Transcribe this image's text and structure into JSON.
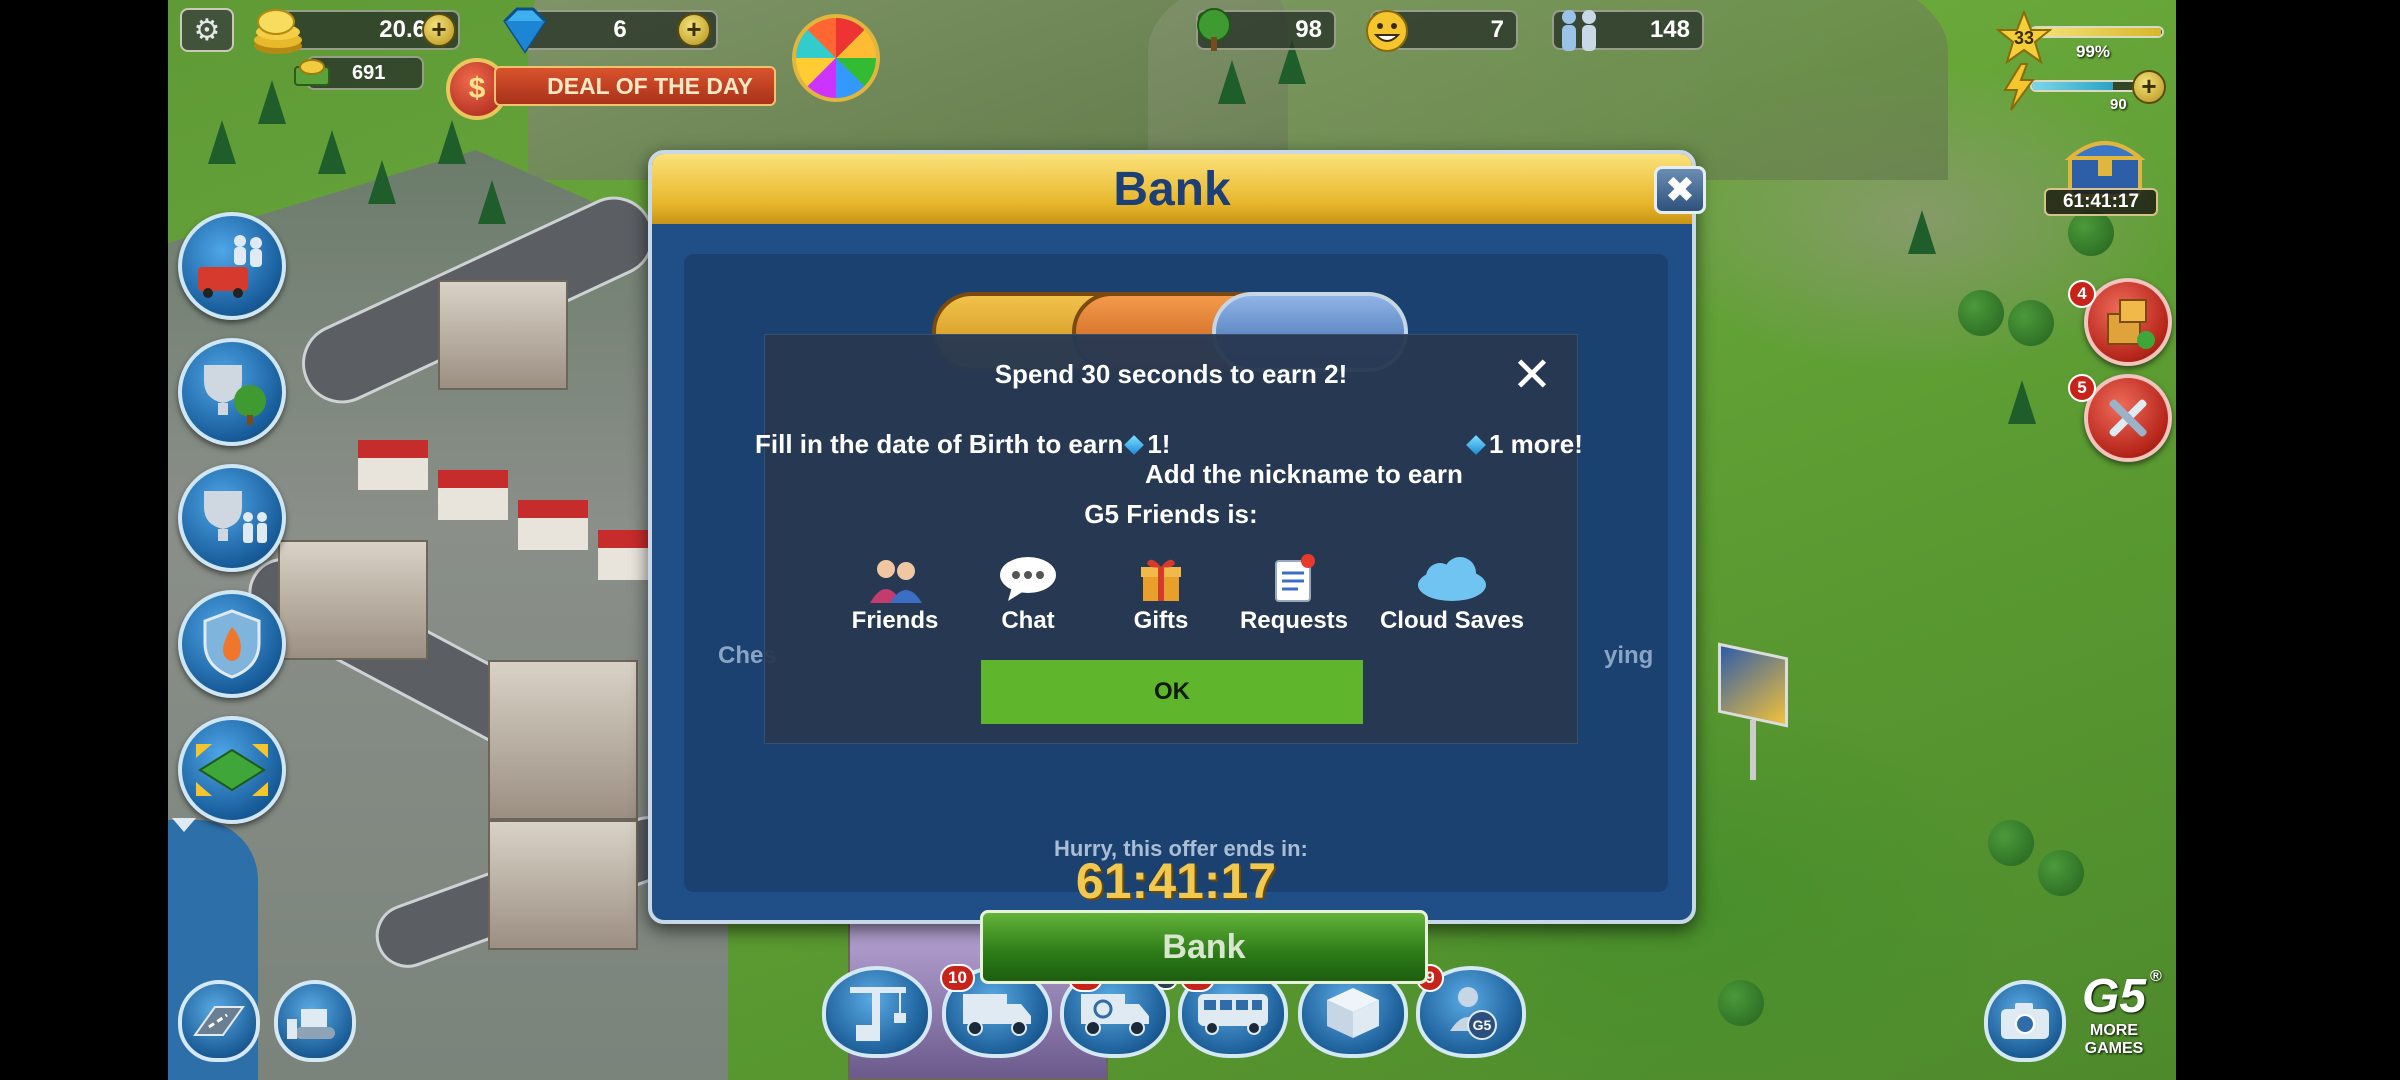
{
  "hud": {
    "coins": "20.6M",
    "gems": "6",
    "dollars": "691",
    "deal_label": "DEAL OF THE DAY",
    "deal_symbol": "$",
    "trees": "98",
    "happiness": "7",
    "population": "148",
    "level": "33",
    "xp_percent_label": "99%",
    "xp_fraction": 0.99,
    "energy": "90",
    "energy_fraction": 0.75,
    "chest_timer": "61:41:17",
    "plus": "+"
  },
  "side_badges": {
    "boxes": "4",
    "repair": "5"
  },
  "bottom_badges": {
    "truck": "10",
    "recycle": "10",
    "recycle_small": "2",
    "bus": "10",
    "friends": "9"
  },
  "bank": {
    "title": "Bank",
    "close": "✖",
    "left_text": "Ches",
    "right_text": "ying",
    "hidden_text": "Hurry, this offer ends in:",
    "timer": "61:41:17",
    "button": "Bank"
  },
  "g5_friends": {
    "title": "Spend 30 seconds to earn  2!",
    "close": "✕",
    "line1": "Fill in the date of Birth to earn",
    "line1_reward": "1!",
    "line2_reward": "1 more!",
    "line2": "Add the nickname to earn",
    "line3": "G5 Friends is:",
    "features": [
      "Friends",
      "Chat",
      "Gifts",
      "Requests",
      "Cloud Saves"
    ],
    "ok": "OK"
  },
  "g5": {
    "logo": "G5",
    "registered": "®",
    "more": "MORE",
    "games": "GAMES"
  },
  "colors": {
    "bank_header": "#e8b72c",
    "bank_body": "#1f4f86",
    "ok_green": "#5fb52b",
    "overlay": "#283852"
  }
}
